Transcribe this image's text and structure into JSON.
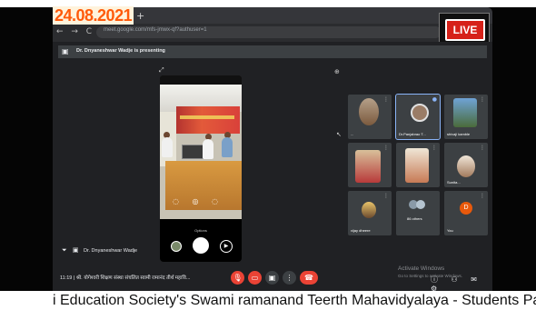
{
  "overlay": {
    "date": "24.08.2021",
    "live_label": "LIVE",
    "ticker_text": "i Education Society's Swami ramanand Teerth Mahavidyalaya - Students Pare"
  },
  "browser": {
    "url": "meet.google.com/mfs-jmwx-qf?authuser=1",
    "tab_menu": "• • ×",
    "new_tab_symbol": "+",
    "nav_symbols": "← → C"
  },
  "meet": {
    "presenting_text": "Dr. Dnyaneshwar Wadje is presenting",
    "presenter_name": "Dr. Dnyaneshwar Wadje",
    "phone_mode_label": "Options",
    "participants": [
      {
        "name": "..."
      },
      {
        "name": "Dr.Panjabrao T..."
      },
      {
        "name": "shivaji kamble"
      },
      {
        "name": ""
      },
      {
        "name": ""
      },
      {
        "name": "Sunita..."
      },
      {
        "name": "vijay dheere"
      },
      {
        "name": "86 others"
      },
      {
        "name": "You",
        "initial": "D"
      }
    ],
    "meeting_info": "11:19 | श्री. योगेश्वरी शिक्षण संस्था संचलित स्वामी रामानंद तीर्थ महावि...",
    "activate_windows": {
      "title": "Activate Windows",
      "subtitle": "Go to Settings to activate Windows."
    }
  },
  "colors": {
    "date_text": "#ff5a0a",
    "live_red": "#d62119",
    "meet_bg": "#202124",
    "tile_bg": "#3c4043",
    "control_red": "#ea4335",
    "active_outline": "#8ab4f8"
  },
  "icons": [
    "present-icon",
    "pin-icon",
    "mic-off-icon",
    "camera-off-icon",
    "present-screen-icon",
    "more-options-icon",
    "end-call-icon",
    "info-icon",
    "people-icon",
    "chat-icon",
    "activities-icon",
    "camera-shutter-icon",
    "switch-camera-icon",
    "gallery-thumbnail-icon"
  ]
}
